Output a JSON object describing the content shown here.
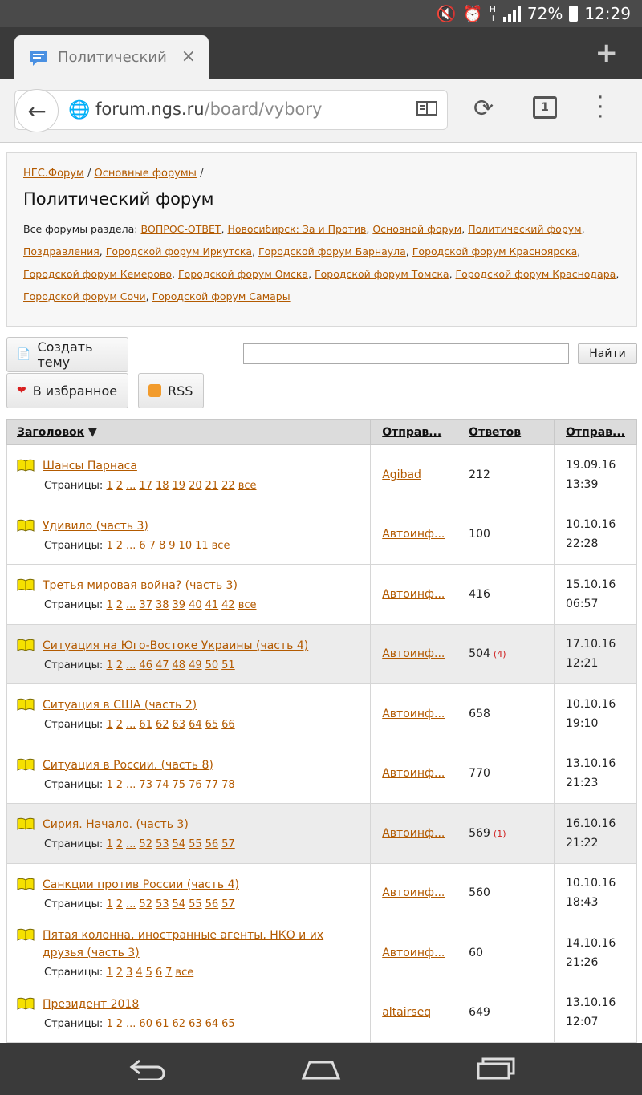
{
  "status": {
    "battery": "72%",
    "time": "12:29"
  },
  "tab": {
    "title": "Политический ф",
    "close": "×",
    "new_tab": "+"
  },
  "toolbar": {
    "url_domain": "forum.ngs.ru",
    "url_path": "/board/vybory",
    "tabs_count": "1"
  },
  "breadcrumb": {
    "item1": "НГС.Форум",
    "sep": " / ",
    "item2": "Основные форумы",
    "tail": " /"
  },
  "page_title": "Политический форум",
  "forums_label": "Все форумы раздела: ",
  "forums": [
    "ВОПРОС-ОТВЕТ",
    "Новосибирск: За и Против",
    "Основной форум",
    "Политический форум",
    "Поздравления",
    "Городской форум Иркутска",
    "Городской форум Барнаула",
    "Городской форум Красноярска",
    "Городской форум Кемерово",
    "Городской форум Омска",
    "Городской форум Томска",
    "Городской форум Краснодара",
    "Городской форум Сочи",
    "Городской форум Самары"
  ],
  "buttons": {
    "create": "Создать тему",
    "favorite": "В избранное",
    "rss": "RSS",
    "search": "Найти"
  },
  "table": {
    "headers": {
      "title": "Заголовок",
      "sort": " ▼",
      "author": "Отправ...",
      "replies": "Ответов",
      "date": "Отправ..."
    },
    "pages_label": "Страницы: ",
    "rows": [
      {
        "title": "Шансы Парнаса",
        "pages": [
          "1",
          "2",
          "...",
          "17",
          "18",
          "19",
          "20",
          "21",
          "22",
          "все"
        ],
        "author": "Agibad",
        "replies": "212",
        "new": "",
        "date": "19.09.16",
        "time": "13:39"
      },
      {
        "title": "Удивило (часть 3)",
        "pages": [
          "1",
          "2",
          "...",
          "6",
          "7",
          "8",
          "9",
          "10",
          "11",
          "все"
        ],
        "author": "Автоинф...",
        "replies": "100",
        "new": "",
        "date": "10.10.16",
        "time": "22:28"
      },
      {
        "title": "Третья мировая война? (часть 3)",
        "pages": [
          "1",
          "2",
          "...",
          "37",
          "38",
          "39",
          "40",
          "41",
          "42",
          "все"
        ],
        "author": "Автоинф...",
        "replies": "416",
        "new": "",
        "date": "15.10.16",
        "time": "06:57"
      },
      {
        "title": "Ситуация на Юго-Востоке Украины (часть 4)",
        "pages": [
          "1",
          "2",
          "...",
          "46",
          "47",
          "48",
          "49",
          "50",
          "51"
        ],
        "author": "Автоинф...",
        "replies": "504",
        "new": "(4)",
        "date": "17.10.16",
        "time": "12:21"
      },
      {
        "title": "Ситуация в США (часть 2)",
        "pages": [
          "1",
          "2",
          "...",
          "61",
          "62",
          "63",
          "64",
          "65",
          "66"
        ],
        "author": "Автоинф...",
        "replies": "658",
        "new": "",
        "date": "10.10.16",
        "time": "19:10"
      },
      {
        "title": "Ситуация в России. (часть 8)",
        "pages": [
          "1",
          "2",
          "...",
          "73",
          "74",
          "75",
          "76",
          "77",
          "78"
        ],
        "author": "Автоинф...",
        "replies": "770",
        "new": "",
        "date": "13.10.16",
        "time": "21:23"
      },
      {
        "title": "Сирия. Начало. (часть 3)",
        "pages": [
          "1",
          "2",
          "...",
          "52",
          "53",
          "54",
          "55",
          "56",
          "57"
        ],
        "author": "Автоинф...",
        "replies": "569",
        "new": "(1)",
        "date": "16.10.16",
        "time": "21:22"
      },
      {
        "title": "Санкции против России (часть 4)",
        "pages": [
          "1",
          "2",
          "...",
          "52",
          "53",
          "54",
          "55",
          "56",
          "57"
        ],
        "author": "Автоинф...",
        "replies": "560",
        "new": "",
        "date": "10.10.16",
        "time": "18:43"
      },
      {
        "title": "Пятая колонна, иностранные агенты, НКО и их друзья (часть 3)",
        "pages": [
          "1",
          "2",
          "3",
          "4",
          "5",
          "6",
          "7",
          "все"
        ],
        "author": "Автоинф...",
        "replies": "60",
        "new": "",
        "date": "14.10.16",
        "time": "21:26"
      },
      {
        "title": "Президент 2018",
        "pages": [
          "1",
          "2",
          "...",
          "60",
          "61",
          "62",
          "63",
          "64",
          "65"
        ],
        "author": "altairseq",
        "replies": "649",
        "new": "",
        "date": "13.10.16",
        "time": "12:07"
      }
    ]
  },
  "colors": {
    "link": "#b35a00",
    "highlight_row": "#ececec",
    "header_bg": "#dcdcdc",
    "new_count": "#d02020"
  }
}
